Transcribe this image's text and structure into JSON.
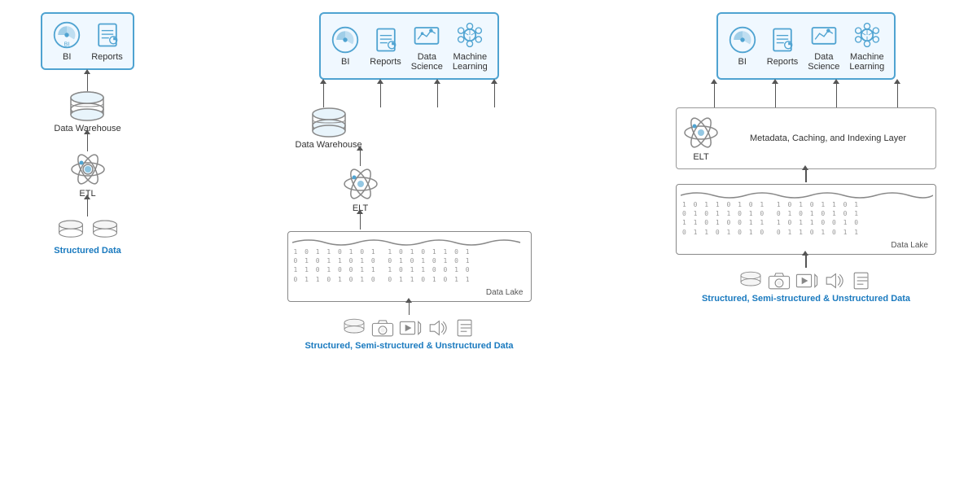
{
  "diagram1": {
    "toolbox": {
      "items": [
        {
          "label": "BI"
        },
        {
          "label": "Reports"
        }
      ]
    },
    "nodes": [
      {
        "id": "dw",
        "label": "Data Warehouse"
      },
      {
        "id": "etl",
        "label": "ETL"
      }
    ],
    "source_label": "Structured Data",
    "datalake_label": ""
  },
  "diagram2": {
    "toolbox": {
      "items": [
        {
          "label": "BI"
        },
        {
          "label": "Reports"
        },
        {
          "label": "Data\nScience"
        },
        {
          "label": "Machine\nLearning"
        }
      ]
    },
    "nodes": [
      {
        "id": "dw",
        "label": "Data Warehouse"
      },
      {
        "id": "elt",
        "label": "ELT"
      }
    ],
    "datalake_label": "Data Lake",
    "source_label": "Structured, Semi-structured & Unstructured Data"
  },
  "diagram3": {
    "toolbox": {
      "items": [
        {
          "label": "BI"
        },
        {
          "label": "Reports"
        },
        {
          "label": "Data\nScience"
        },
        {
          "label": "Machine\nLearning"
        }
      ]
    },
    "nodes": [
      {
        "id": "elt",
        "label": "ELT"
      },
      {
        "id": "meta",
        "label": "Metadata, Caching, and\nIndexing Layer"
      }
    ],
    "datalake_label": "Data Lake",
    "source_label": "Structured, Semi-structured & Unstructured Data"
  },
  "binary_pattern": "1 0 1 1 0 1 0 1  1 0 1 0 1 1 0 1\n0 1 0 1 1 0 1 0  0 1 0 1 0 1 0 1\n1 1 0 1 0 0 1 1  1 0 1 1 0 0 1 0\n0 1 1 0 1 0 1 0  0 1 1 0 1 0 1 1"
}
